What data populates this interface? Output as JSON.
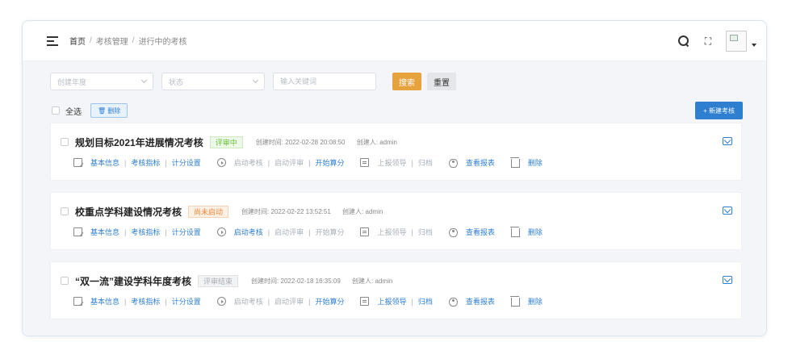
{
  "breadcrumb": {
    "home": "首页",
    "sep": "/",
    "level1": "考核管理",
    "level2": "进行中的考核"
  },
  "filters": {
    "year_placeholder": "创建年度",
    "status_placeholder": "状态",
    "keyword_placeholder": "输入关键词",
    "search_label": "搜索",
    "reset_label": "重置"
  },
  "toolbar": {
    "select_all": "全选",
    "delete_label": "🗑 删除",
    "new_label": "+ 新建考核"
  },
  "colors": {
    "primary": "#2f7fd1",
    "warning": "#e6a23c"
  },
  "labels": {
    "created_time": "创建时间:",
    "creator": "创建人:",
    "basic_info": "基本信息",
    "indicators": "考核指标",
    "scoring": "计分设置",
    "start_assess": "启动考核",
    "start_review": "启动评审",
    "start_calc": "开始算分",
    "report_leader": "上报领导",
    "archive": "归档",
    "view_report": "查看报表",
    "delete": "删除",
    "sep": "|"
  },
  "cards": [
    {
      "title": "规划目标2021年进展情况考核",
      "status": "评审中",
      "created": "2022-02-28 20:08:50",
      "creator": "admin"
    },
    {
      "title": "校重点学科建设情况考核",
      "status": "尚未启动",
      "created": "2022-02-22 13:52:51",
      "creator": "admin"
    },
    {
      "title": "“双一流”建设学科年度考核",
      "status": "评审结束",
      "created": "2022-02-18 16:35:09",
      "creator": "admin"
    }
  ]
}
